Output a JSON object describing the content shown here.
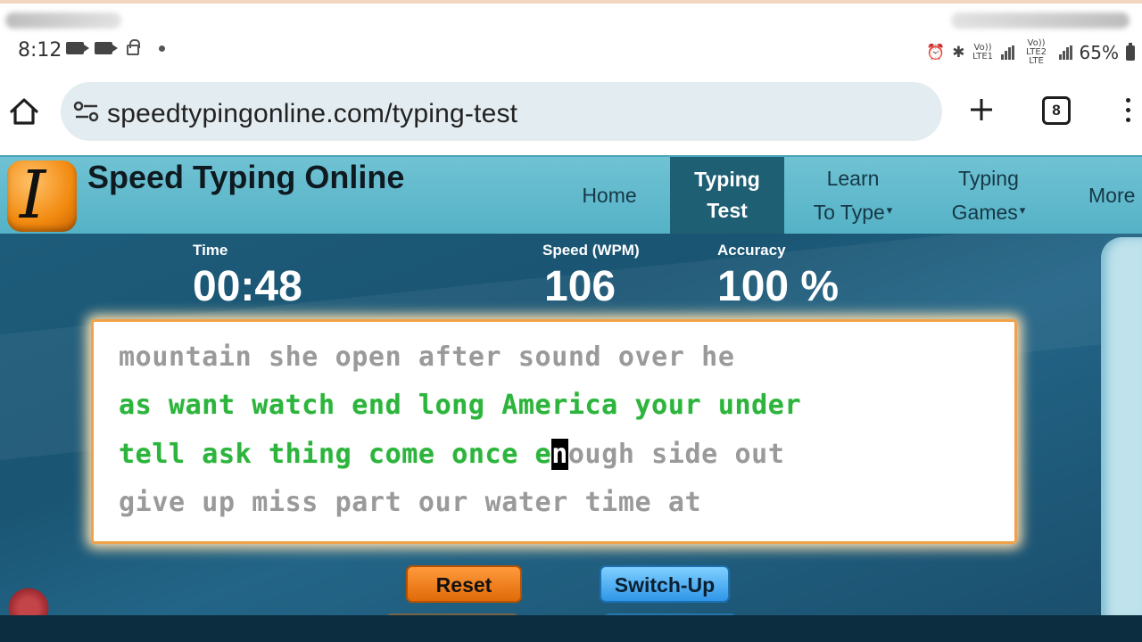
{
  "status_bar": {
    "time": "8:12",
    "battery": "65%",
    "net1": "Vo)) LTE1",
    "net2": "Vo)) LTE2 LTE",
    "icons": [
      "video-camera-icon",
      "video-camera-icon",
      "lock-icon",
      "dot-icon",
      "alarm-icon",
      "bluetooth-icon",
      "signal-icon",
      "battery-icon"
    ]
  },
  "browser": {
    "url": "speedtypingonline.com/typing-test",
    "tab_count": "8",
    "icons": [
      "home-icon",
      "tune-icon",
      "plus-icon",
      "tabs-icon",
      "more-vert-icon"
    ]
  },
  "site": {
    "title": "Speed Typing Online",
    "logo_letter": "I",
    "nav": {
      "home": "Home",
      "typing_test_l1": "Typing",
      "typing_test_l2": "Test",
      "learn_l1": "Learn",
      "learn_l2": "To Type",
      "games_l1": "Typing",
      "games_l2": "Games",
      "more": "More",
      "caret": "▾"
    }
  },
  "stats": {
    "time_label": "Time",
    "time_value": "00:48",
    "speed_label": "Speed (WPM)",
    "speed_value": "106",
    "accuracy_label": "Accuracy",
    "accuracy_value": "100 %"
  },
  "typing_text": {
    "line1": "mountain she open after sound over he",
    "line2": "as want watch end long America your under",
    "line3_typed": "tell ask thing come once e",
    "line3_cursor": "n",
    "line3_rest": "ough side out",
    "line4": "give up miss part our water time at"
  },
  "buttons": {
    "reset": "Reset",
    "switch_up": "Switch-Up"
  },
  "colors": {
    "typed_text": "#2db43c",
    "untyped_text": "#9a9a9a",
    "header_bg": "#5cb8cb",
    "active_nav": "#1f5f74",
    "reset_button": "#f28a20",
    "switch_button": "#4aaaf0"
  }
}
